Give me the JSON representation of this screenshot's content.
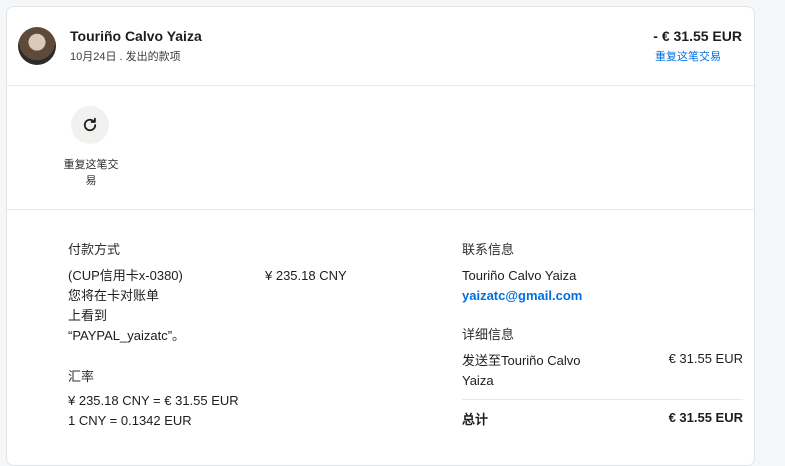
{
  "header": {
    "name": "Touriño Calvo Yaiza",
    "subtitle": "10月24日 . 发出的款项",
    "amount": "- € 31.55 EUR",
    "repeat_link": "重复这笔交易"
  },
  "actions": {
    "repeat_label": "重复这笔交易",
    "repeat_icon": "refresh-icon"
  },
  "payment": {
    "title": "付款方式",
    "card_desc": "(CUP信用卡x-0380)\n您将在卡对账单\n上看到\n“PAYPAL_yaizatc”。",
    "cny_amount": "¥ 235.18 CNY"
  },
  "exchange": {
    "title": "汇率",
    "line1": "¥ 235.18 CNY = € 31.55 EUR",
    "line2": "1 CNY = 0.1342 EUR"
  },
  "contact": {
    "title": "联系信息",
    "name": "Touriño Calvo Yaiza",
    "email": "yaizatc@gmail.com"
  },
  "detail": {
    "title": "详细信息",
    "sent_to": "发送至Touriño Calvo\nYaiza",
    "sent_amount": "€ 31.55 EUR",
    "total_label": "总计",
    "total_amount": "€ 31.55 EUR"
  },
  "colors": {
    "link": "#0070e0",
    "text": "#2c2e2f",
    "divider": "#e6e8ea"
  }
}
